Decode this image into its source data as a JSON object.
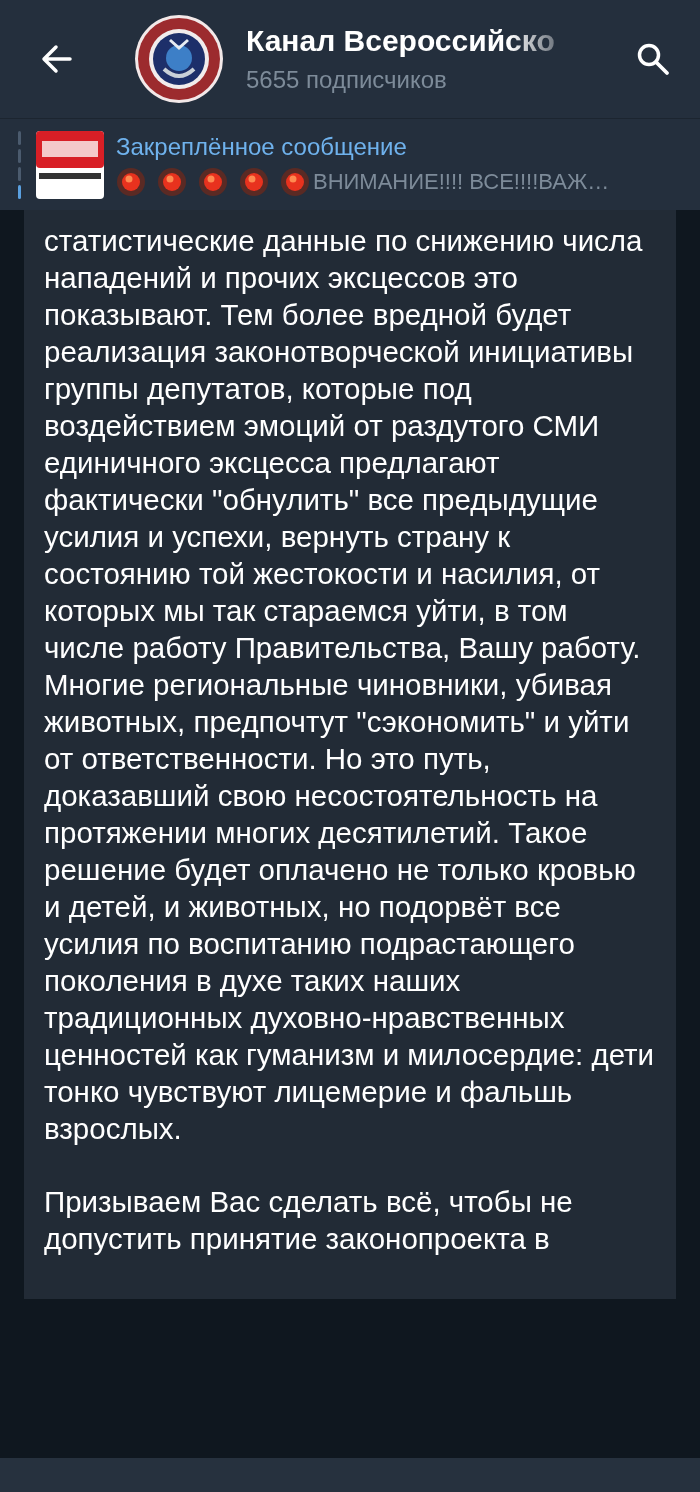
{
  "header": {
    "title": "Канал Всероссийско",
    "subtitle": "5655 подписчиков"
  },
  "pinned": {
    "label": "Закреплённое сообщение",
    "emoji": [
      {
        "kind": "red-circle"
      },
      {
        "kind": "red-circle"
      },
      {
        "kind": "red-circle"
      },
      {
        "kind": "red-circle"
      },
      {
        "kind": "red-circle"
      }
    ],
    "preview": "ВНИМАНИЕ!!!! ВСЕ!!!!ВАЖ…"
  },
  "message": {
    "paragraphs": [
      "статистические данные по снижению числа нападений и прочих эксцессов это показывают. Тем более вредной будет реализация законотворческой инициативы группы депутатов, которые под воздействием эмоций от раздутого СМИ единичного эксцесса предлагают фактически \"обнулить\" все предыдущие усилия и успехи, вернуть страну к состоянию той жестокости и насилия, от которых мы так стараемся уйти, в том числе работу Правительства, Вашу работу. Многие региональные чиновники, убивая животных, предпочтут \"сэкономить\" и уйти от ответственности. Но это путь, доказавший свою несостоятельность на протяжении многих десятилетий. Такое решение будет оплачено не только кровью и детей, и животных, но подорвёт все усилия по воспитанию подрастающего поколения в духе таких наших традиционных духовно-нравственных ценностей как гуманизм и милосердие: дети тонко чувствуют лицемерие и фальшь взрослых.",
      "Призываем Вас сделать всё, чтобы не допустить принятие законопроекта в"
    ]
  }
}
